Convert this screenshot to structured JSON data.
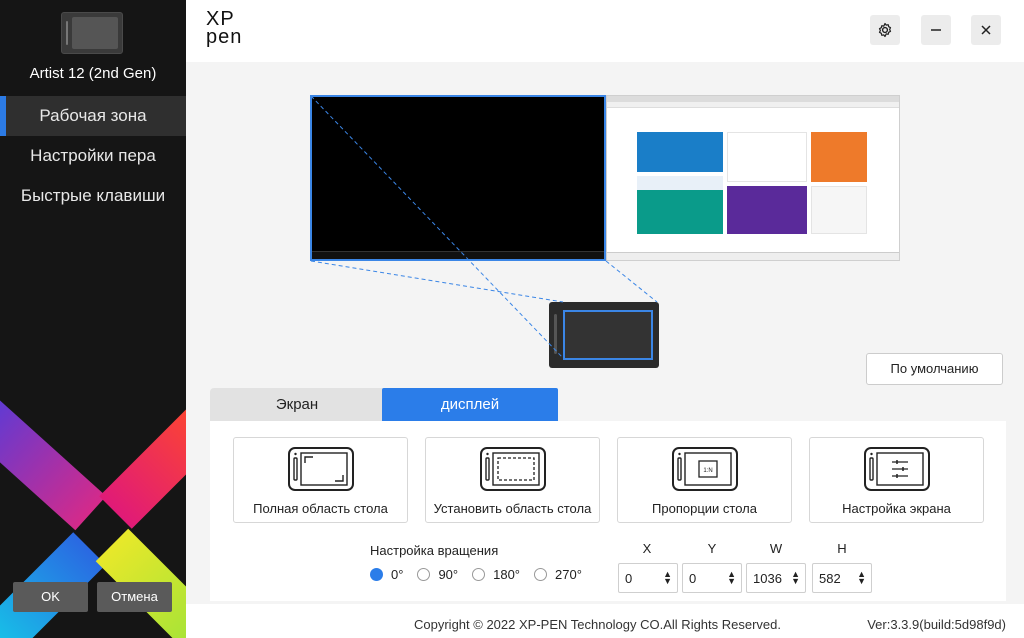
{
  "app": {
    "logo_line1": "XP",
    "logo_line2": "pen",
    "device_name": "Artist 12 (2nd Gen)"
  },
  "sidebar": {
    "items": [
      {
        "label": "Рабочая зона",
        "active": true
      },
      {
        "label": "Настройки пера",
        "active": false
      },
      {
        "label": "Быстрые клавиши",
        "active": false
      }
    ],
    "ok_label": "OK",
    "cancel_label": "Отмена"
  },
  "header": {
    "settings_icon": "gear-icon",
    "minimize_icon": "minimize-icon",
    "close_icon": "close-icon"
  },
  "main": {
    "default_button": "По умолчанию",
    "tabs": [
      {
        "label": "Экран",
        "active": false
      },
      {
        "label": "дисплей",
        "active": true
      }
    ],
    "modes": [
      {
        "label": "Полная область стола",
        "icon": "full-area-icon"
      },
      {
        "label": "Установить область стола",
        "icon": "set-area-icon"
      },
      {
        "label": "Пропорции стола",
        "icon": "proportion-icon"
      },
      {
        "label": "Настройка экрана",
        "icon": "screen-adjust-icon"
      }
    ],
    "rotation": {
      "title": "Настройка вращения",
      "options": [
        "0°",
        "90°",
        "180°",
        "270°"
      ],
      "selected": "0°"
    },
    "fields": {
      "x": {
        "label": "X",
        "value": "0"
      },
      "y": {
        "label": "Y",
        "value": "0"
      },
      "w": {
        "label": "W",
        "value": "1036"
      },
      "h": {
        "label": "H",
        "value": "582"
      }
    }
  },
  "footer": {
    "copyright": "Copyright © 2022  XP-PEN Technology CO.All Rights Reserved.",
    "version": "Ver:3.3.9(build:5d98f9d)"
  },
  "colors": {
    "accent": "#2b7de9",
    "sidebar_bg": "#151515"
  }
}
